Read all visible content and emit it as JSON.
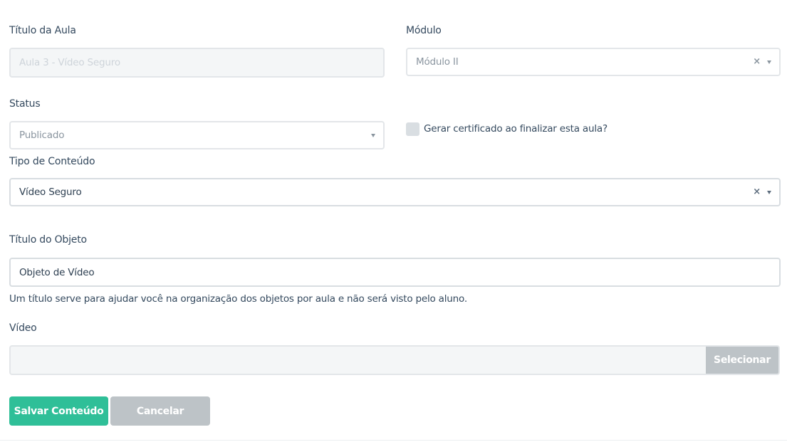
{
  "form": {
    "lesson_title": {
      "label": "Título da Aula",
      "value": "Aula 3 - Vídeo Seguro"
    },
    "module": {
      "label": "Módulo",
      "value": "Módulo II"
    },
    "status": {
      "label": "Status",
      "value": "Publicado"
    },
    "certificate": {
      "label": "Gerar certificado ao finalizar esta aula?",
      "checked": false
    },
    "content_type": {
      "label": "Tipo de Conteúdo",
      "value": "Vídeo Seguro"
    },
    "object_title": {
      "label": "Título do Objeto",
      "value": "Objeto de Vídeo",
      "help": "Um título serve para ajudar você na organização dos objetos por aula e não será visto pelo aluno."
    },
    "video": {
      "label": "Vídeo",
      "value": "",
      "select_label": "Selecionar"
    },
    "clear_glyph": "×"
  },
  "actions": {
    "save_label": "Salvar Conteúdo",
    "cancel_label": "Cancelar"
  },
  "colors": {
    "primary": "#2fbf98",
    "secondary": "#bdc3c7",
    "text": "#34495e"
  }
}
